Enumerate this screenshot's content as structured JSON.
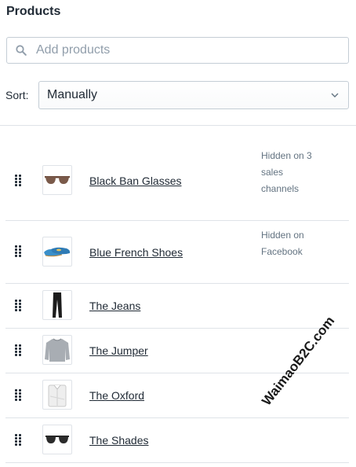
{
  "header": {
    "title": "Products"
  },
  "search": {
    "placeholder": "Add products",
    "value": "",
    "icon": "search-icon"
  },
  "sort": {
    "label": "Sort:",
    "selected": "Manually",
    "icon": "chevron-down-icon"
  },
  "products": [
    {
      "name": "Black Ban Glasses",
      "status": "Hidden on 3 sales channels",
      "image": "sunglasses"
    },
    {
      "name": "Blue French Shoes",
      "status": "Hidden on Facebook",
      "image": "blue shoes"
    },
    {
      "name": "The Jeans",
      "status": "",
      "image": "jeans"
    },
    {
      "name": "The Jumper",
      "status": "",
      "image": "grey jumper"
    },
    {
      "name": "The Oxford",
      "status": "",
      "image": "white shirt"
    },
    {
      "name": "The Shades",
      "status": "",
      "image": "dark sunglasses"
    }
  ],
  "watermark": "WaimaoB2C.com",
  "colors": {
    "text": "#212b36",
    "muted": "#637381",
    "border": "#c4cdd5",
    "divider": "#dfe3e8"
  }
}
